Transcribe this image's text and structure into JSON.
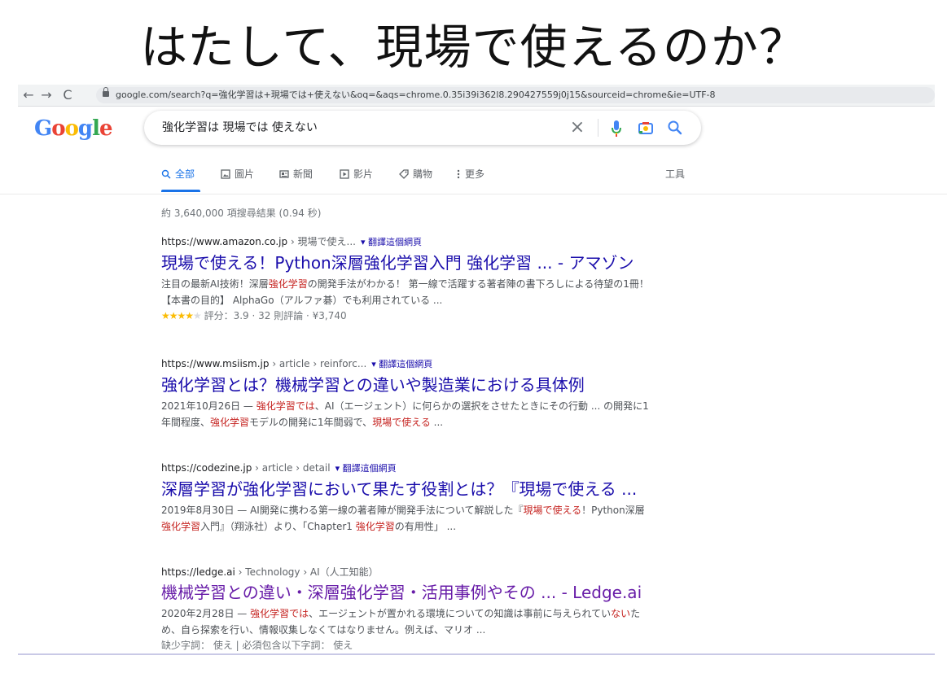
{
  "slide": {
    "title": "はたして、現場で使えるのか？"
  },
  "browser": {
    "back_icon": "←",
    "forward_icon": "→",
    "reload_icon": "C",
    "url": "google.com/search?q=強化学習は+現場では+使えない&oq=&aqs=chrome.0.35i39i362l8.290427559j0j15&sourceid=chrome&ie=UTF-8"
  },
  "logo": {
    "text": "Google"
  },
  "search": {
    "query": "強化学習は 現場では 使えない",
    "clear": "×"
  },
  "tabs": [
    {
      "label": "全部",
      "icon": "search-icon"
    },
    {
      "label": "圖片",
      "icon": "image-icon"
    },
    {
      "label": "新聞",
      "icon": "news-icon"
    },
    {
      "label": "影片",
      "icon": "video-icon"
    },
    {
      "label": "購物",
      "icon": "tag-icon"
    },
    {
      "label": "更多",
      "icon": "more-icon"
    }
  ],
  "tools_label": "工具",
  "stats": "約 3,640,000 項搜尋結果 (0.94 秒)",
  "results": [
    {
      "site": "https://www.amazon.co.jp",
      "crumb": " › 現場で使え...",
      "translate": "▾ 翻譯這個網頁",
      "title": "現場で使える！Python深層強化学習入門 強化学習 ... - アマゾン",
      "snippet_a": "注目の最新AI技術！深層",
      "snippet_hl": "強化学習",
      "snippet_b": "の開発手法がわかる！ 第一線で活躍する著者陣の書下ろしによる待望の1冊！ 【本書の目的】 AlphaGo（アルファ碁）でも利用されている ...",
      "stars": "★★★★",
      "star_off": "★",
      "rating": " 評分：3.9 · 32 則評論 · ¥3,740"
    },
    {
      "site": "https://www.msiism.jp",
      "crumb": " › article › reinforc...",
      "translate": "▾ 翻譯這個網頁",
      "title": "強化学習とは？機械学習との違いや製造業における具体例",
      "snip_1": "2021年10月26日 — ",
      "snip_2": "強化学習では",
      "snip_3": "、AI（エージェント）に何らかの選択をさせたときにその行動 ... の開発に1年間程度、",
      "snip_4": "強化学習",
      "snip_5": "モデルの開発に1年間弱で、",
      "snip_6": "現場で使える",
      "snip_7": " ..."
    },
    {
      "site": "https://codezine.jp",
      "crumb": " › article › detail",
      "translate": "▾ 翻譯這個網頁",
      "title": "深層学習が強化学習において果たす役割とは？『現場で使える ...",
      "snip_1": "2019年8月30日 — AI開発に携わる第一線の著者陣が開発手法について解説した『",
      "snip_2": "現場で使える",
      "snip_3": "！Python深層",
      "snip_4": "強化学習",
      "snip_5": "入門』（翔泳社）より、「Chapter1 ",
      "snip_6": "強化学習",
      "snip_7": "の有用性」 ..."
    },
    {
      "site": "https://ledge.ai",
      "crumb": " › Technology › AI（人工知能）",
      "title": "機械学習との違い・深層強化学習・活用事例やその ... - Ledge.ai",
      "snip_1": "2020年2月28日 — ",
      "snip_2": "強化学習では",
      "snip_3": "、エージェントが置かれる環境についての知識は事前に与えられてい",
      "snip_4": "ない",
      "snip_5": "ため、自ら探索を行い、情報収集しなくてはなりません。例えば、マリオ ...",
      "missing": "缺少字詞： 使え | 必須包含以下字詞： 使え"
    }
  ]
}
